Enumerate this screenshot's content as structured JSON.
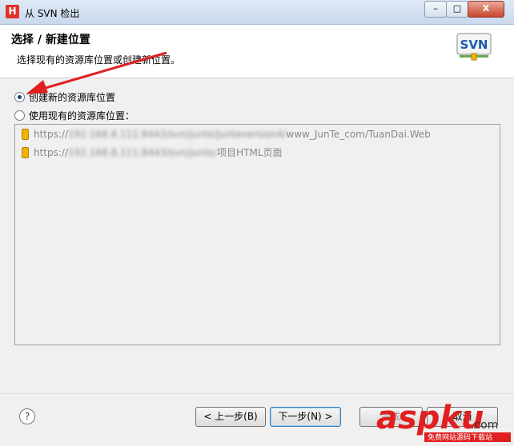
{
  "window": {
    "app_icon_letter": "H",
    "title": "从 SVN 检出",
    "min_label": "–",
    "max_label": "□",
    "close_label": "X"
  },
  "header": {
    "title": "选择 / 新建位置",
    "description": "选择现有的资源库位置或创建新位置。",
    "logo_text": "SVN"
  },
  "options": {
    "create_new": {
      "label": "创建新的资源库位置",
      "checked": true
    },
    "use_existing": {
      "label": "使用现有的资源库位置：",
      "checked": false
    }
  },
  "repositories": [
    {
      "url_prefix": "https://",
      "url_hidden": "192.168.8.111:8443/svn/junte/junteversion4/",
      "url_suffix": "www_JunTe_com/TuanDai.Web"
    },
    {
      "url_prefix": "https://",
      "url_hidden": "192.168.8.111:8443/svn/junte/",
      "url_suffix": "项目HTML页面"
    }
  ],
  "footer": {
    "help_label": "?",
    "back_label": "< 上一步(B)",
    "next_label": "下一步(N) >",
    "finish_label": "完成",
    "cancel_label": "取消"
  },
  "watermark": {
    "text": "aspku",
    "suffix": ".com",
    "subtitle": "免费网站源码下载站"
  },
  "colors": {
    "arrow": "#e02020",
    "accent": "#3c7fb1"
  }
}
